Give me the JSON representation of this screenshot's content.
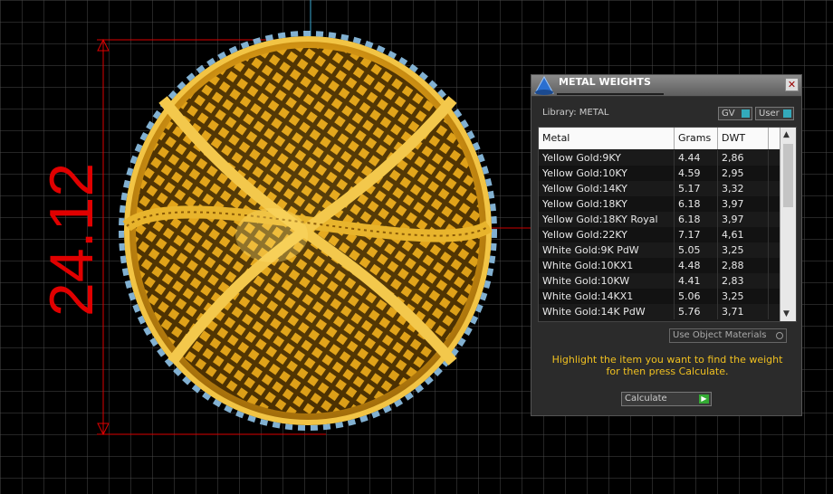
{
  "dimension_label": "24.12",
  "panel": {
    "title": "METAL WEIGHTS",
    "close": "✕",
    "library": "Library: METAL",
    "toggle_gv": "GV",
    "toggle_user": "User",
    "columns": [
      "Metal",
      "Grams",
      "DWT"
    ],
    "rows": [
      {
        "metal": "Yellow Gold:9KY",
        "grams": "4.44",
        "dwt": "2,86"
      },
      {
        "metal": "Yellow Gold:10KY",
        "grams": "4.59",
        "dwt": "2,95"
      },
      {
        "metal": "Yellow Gold:14KY",
        "grams": "5.17",
        "dwt": "3,32"
      },
      {
        "metal": "Yellow Gold:18KY",
        "grams": "6.18",
        "dwt": "3,97"
      },
      {
        "metal": "Yellow Gold:18KY Royal",
        "grams": "6.18",
        "dwt": "3,97"
      },
      {
        "metal": "Yellow Gold:22KY",
        "grams": "7.17",
        "dwt": "4,61"
      },
      {
        "metal": "White Gold:9K PdW",
        "grams": "5.05",
        "dwt": "3,25"
      },
      {
        "metal": "White Gold:10KX1",
        "grams": "4.48",
        "dwt": "2,88"
      },
      {
        "metal": "White Gold:10KW",
        "grams": "4.41",
        "dwt": "2,83"
      },
      {
        "metal": "White Gold:14KX1",
        "grams": "5.06",
        "dwt": "3,25"
      },
      {
        "metal": "White Gold:14K PdW",
        "grams": "5.76",
        "dwt": "3,71"
      }
    ],
    "use_object_materials": "Use Object Materials",
    "hint": "Highlight the item you want to find the weight for then press Calculate.",
    "calculate": "Calculate"
  }
}
